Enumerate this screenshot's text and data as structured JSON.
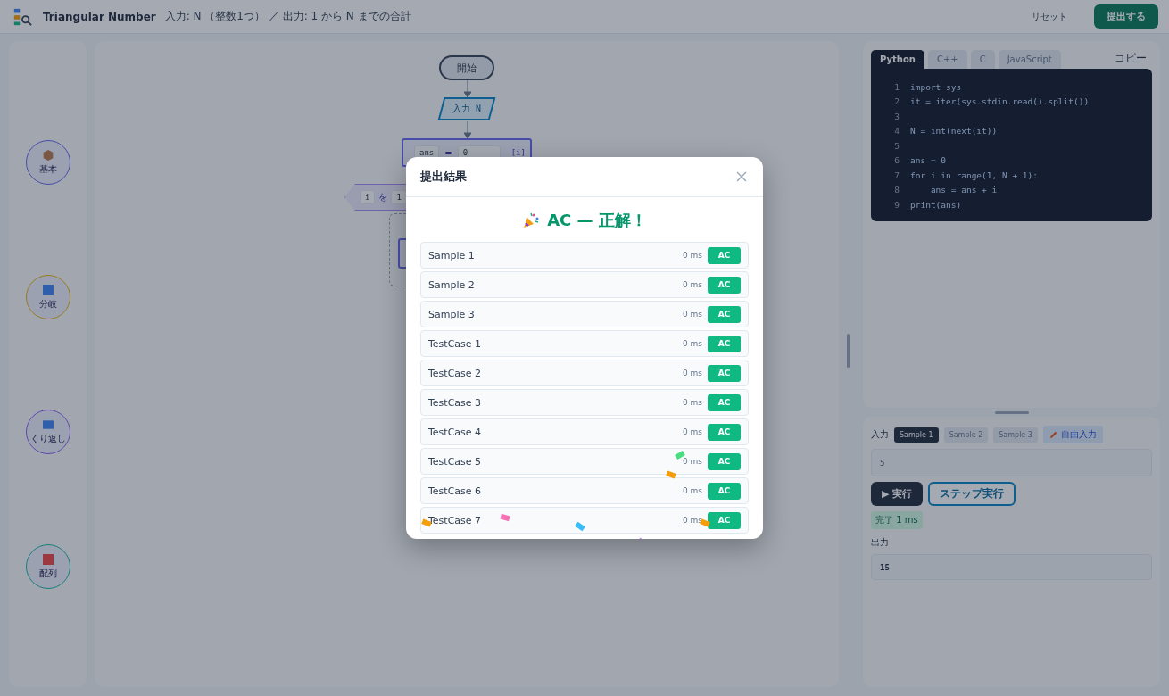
{
  "header": {
    "title": "Triangular Number",
    "subtitle": "入力: N （整数1つ） ／ 出力: 1 から N までの合計",
    "reset": "リセット",
    "submit": "提出する"
  },
  "palette": [
    {
      "label": "基本",
      "kind": "basic"
    },
    {
      "label": "分岐",
      "kind": "branch"
    },
    {
      "label": "くり返し",
      "kind": "loop"
    },
    {
      "label": "配列",
      "kind": "array"
    }
  ],
  "flow": {
    "start": "開始",
    "input": "入力 N",
    "assign": {
      "var": "ans",
      "op": "=",
      "value": "0",
      "index": "[i]"
    },
    "loop": {
      "var": "i",
      "particle": "を",
      "from": "1"
    }
  },
  "code": {
    "tabs": [
      {
        "label": "Python",
        "selected": true
      },
      {
        "label": "C++",
        "selected": false
      },
      {
        "label": "C",
        "selected": false
      },
      {
        "label": "JavaScript",
        "selected": false
      }
    ],
    "copy": "コピー",
    "lines": [
      {
        "no": "1",
        "text": "import sys"
      },
      {
        "no": "2",
        "text": "it = iter(sys.stdin.read().split())"
      },
      {
        "no": "3"
      },
      {
        "no": "4",
        "text": "N = int(next(it))"
      },
      {
        "no": "5"
      },
      {
        "no": "6",
        "text": "ans = 0"
      },
      {
        "no": "7",
        "text": "for i in range(1, N + 1):"
      },
      {
        "no": "8",
        "text": "    ans = ans + i"
      },
      {
        "no": "9",
        "text": "print(ans)"
      }
    ]
  },
  "io": {
    "input_label": "入力",
    "samples": [
      {
        "label": "Sample 1",
        "selected": true
      },
      {
        "label": "Sample 2",
        "selected": false
      },
      {
        "label": "Sample 3",
        "selected": false
      }
    ],
    "free_input": "自由入力",
    "input_value": "5",
    "run": "▶ 実行",
    "step": "ステップ実行",
    "status": "完了 1 ms",
    "output_label": "出力",
    "output_value": "15"
  },
  "modal": {
    "title": "提出結果",
    "result": "AC — 正解！",
    "rows": [
      {
        "name": "Sample 1",
        "time": "0 ms",
        "verdict": "AC"
      },
      {
        "name": "Sample 2",
        "time": "0 ms",
        "verdict": "AC"
      },
      {
        "name": "Sample 3",
        "time": "0 ms",
        "verdict": "AC"
      },
      {
        "name": "TestCase 1",
        "time": "0 ms",
        "verdict": "AC"
      },
      {
        "name": "TestCase 2",
        "time": "0 ms",
        "verdict": "AC"
      },
      {
        "name": "TestCase 3",
        "time": "0 ms",
        "verdict": "AC"
      },
      {
        "name": "TestCase 4",
        "time": "0 ms",
        "verdict": "AC"
      },
      {
        "name": "TestCase 5",
        "time": "0 ms",
        "verdict": "AC"
      },
      {
        "name": "TestCase 6",
        "time": "0 ms",
        "verdict": "AC"
      },
      {
        "name": "TestCase 7",
        "time": "0 ms",
        "verdict": "AC"
      }
    ]
  }
}
